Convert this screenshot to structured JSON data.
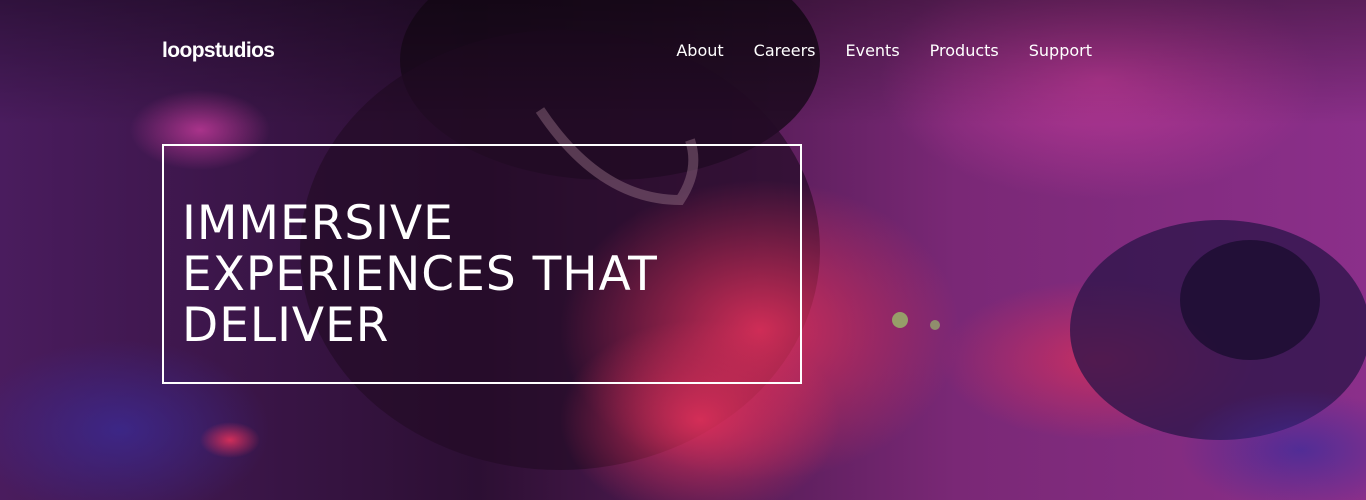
{
  "header": {
    "logo": "loopstudios",
    "nav": [
      {
        "label": "About"
      },
      {
        "label": "Careers"
      },
      {
        "label": "Events"
      },
      {
        "label": "Products"
      },
      {
        "label": "Support"
      }
    ]
  },
  "hero": {
    "title_lines": [
      "IMMERSIVE",
      "EXPERIENCES THAT",
      "DELIVER"
    ],
    "colors": {
      "overlay": "#1a0a25",
      "magenta": "#9a2a88",
      "red": "#c81e4a",
      "text": "#ffffff"
    }
  }
}
